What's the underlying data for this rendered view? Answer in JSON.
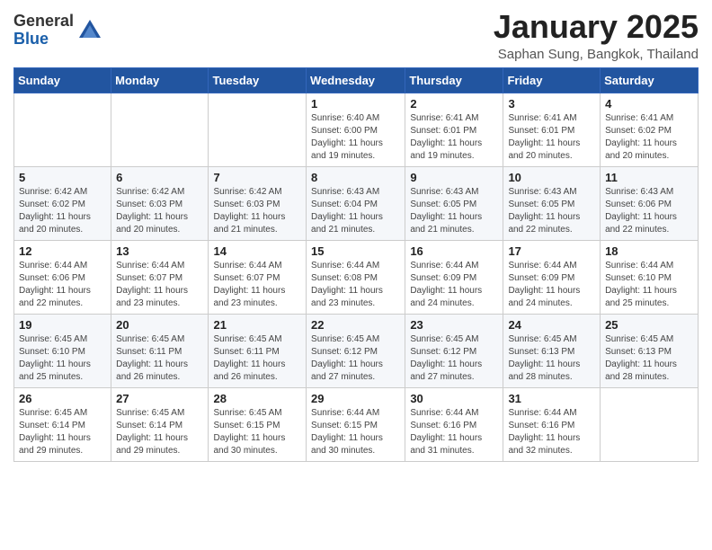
{
  "logo": {
    "general": "General",
    "blue": "Blue"
  },
  "title": {
    "month": "January 2025",
    "location": "Saphan Sung, Bangkok, Thailand"
  },
  "weekdays": [
    "Sunday",
    "Monday",
    "Tuesday",
    "Wednesday",
    "Thursday",
    "Friday",
    "Saturday"
  ],
  "weeks": [
    [
      {
        "day": "",
        "info": ""
      },
      {
        "day": "",
        "info": ""
      },
      {
        "day": "",
        "info": ""
      },
      {
        "day": "1",
        "info": "Sunrise: 6:40 AM\nSunset: 6:00 PM\nDaylight: 11 hours and 19 minutes."
      },
      {
        "day": "2",
        "info": "Sunrise: 6:41 AM\nSunset: 6:01 PM\nDaylight: 11 hours and 19 minutes."
      },
      {
        "day": "3",
        "info": "Sunrise: 6:41 AM\nSunset: 6:01 PM\nDaylight: 11 hours and 20 minutes."
      },
      {
        "day": "4",
        "info": "Sunrise: 6:41 AM\nSunset: 6:02 PM\nDaylight: 11 hours and 20 minutes."
      }
    ],
    [
      {
        "day": "5",
        "info": "Sunrise: 6:42 AM\nSunset: 6:02 PM\nDaylight: 11 hours and 20 minutes."
      },
      {
        "day": "6",
        "info": "Sunrise: 6:42 AM\nSunset: 6:03 PM\nDaylight: 11 hours and 20 minutes."
      },
      {
        "day": "7",
        "info": "Sunrise: 6:42 AM\nSunset: 6:03 PM\nDaylight: 11 hours and 21 minutes."
      },
      {
        "day": "8",
        "info": "Sunrise: 6:43 AM\nSunset: 6:04 PM\nDaylight: 11 hours and 21 minutes."
      },
      {
        "day": "9",
        "info": "Sunrise: 6:43 AM\nSunset: 6:05 PM\nDaylight: 11 hours and 21 minutes."
      },
      {
        "day": "10",
        "info": "Sunrise: 6:43 AM\nSunset: 6:05 PM\nDaylight: 11 hours and 22 minutes."
      },
      {
        "day": "11",
        "info": "Sunrise: 6:43 AM\nSunset: 6:06 PM\nDaylight: 11 hours and 22 minutes."
      }
    ],
    [
      {
        "day": "12",
        "info": "Sunrise: 6:44 AM\nSunset: 6:06 PM\nDaylight: 11 hours and 22 minutes."
      },
      {
        "day": "13",
        "info": "Sunrise: 6:44 AM\nSunset: 6:07 PM\nDaylight: 11 hours and 23 minutes."
      },
      {
        "day": "14",
        "info": "Sunrise: 6:44 AM\nSunset: 6:07 PM\nDaylight: 11 hours and 23 minutes."
      },
      {
        "day": "15",
        "info": "Sunrise: 6:44 AM\nSunset: 6:08 PM\nDaylight: 11 hours and 23 minutes."
      },
      {
        "day": "16",
        "info": "Sunrise: 6:44 AM\nSunset: 6:09 PM\nDaylight: 11 hours and 24 minutes."
      },
      {
        "day": "17",
        "info": "Sunrise: 6:44 AM\nSunset: 6:09 PM\nDaylight: 11 hours and 24 minutes."
      },
      {
        "day": "18",
        "info": "Sunrise: 6:44 AM\nSunset: 6:10 PM\nDaylight: 11 hours and 25 minutes."
      }
    ],
    [
      {
        "day": "19",
        "info": "Sunrise: 6:45 AM\nSunset: 6:10 PM\nDaylight: 11 hours and 25 minutes."
      },
      {
        "day": "20",
        "info": "Sunrise: 6:45 AM\nSunset: 6:11 PM\nDaylight: 11 hours and 26 minutes."
      },
      {
        "day": "21",
        "info": "Sunrise: 6:45 AM\nSunset: 6:11 PM\nDaylight: 11 hours and 26 minutes."
      },
      {
        "day": "22",
        "info": "Sunrise: 6:45 AM\nSunset: 6:12 PM\nDaylight: 11 hours and 27 minutes."
      },
      {
        "day": "23",
        "info": "Sunrise: 6:45 AM\nSunset: 6:12 PM\nDaylight: 11 hours and 27 minutes."
      },
      {
        "day": "24",
        "info": "Sunrise: 6:45 AM\nSunset: 6:13 PM\nDaylight: 11 hours and 28 minutes."
      },
      {
        "day": "25",
        "info": "Sunrise: 6:45 AM\nSunset: 6:13 PM\nDaylight: 11 hours and 28 minutes."
      }
    ],
    [
      {
        "day": "26",
        "info": "Sunrise: 6:45 AM\nSunset: 6:14 PM\nDaylight: 11 hours and 29 minutes."
      },
      {
        "day": "27",
        "info": "Sunrise: 6:45 AM\nSunset: 6:14 PM\nDaylight: 11 hours and 29 minutes."
      },
      {
        "day": "28",
        "info": "Sunrise: 6:45 AM\nSunset: 6:15 PM\nDaylight: 11 hours and 30 minutes."
      },
      {
        "day": "29",
        "info": "Sunrise: 6:44 AM\nSunset: 6:15 PM\nDaylight: 11 hours and 30 minutes."
      },
      {
        "day": "30",
        "info": "Sunrise: 6:44 AM\nSunset: 6:16 PM\nDaylight: 11 hours and 31 minutes."
      },
      {
        "day": "31",
        "info": "Sunrise: 6:44 AM\nSunset: 6:16 PM\nDaylight: 11 hours and 32 minutes."
      },
      {
        "day": "",
        "info": ""
      }
    ]
  ]
}
